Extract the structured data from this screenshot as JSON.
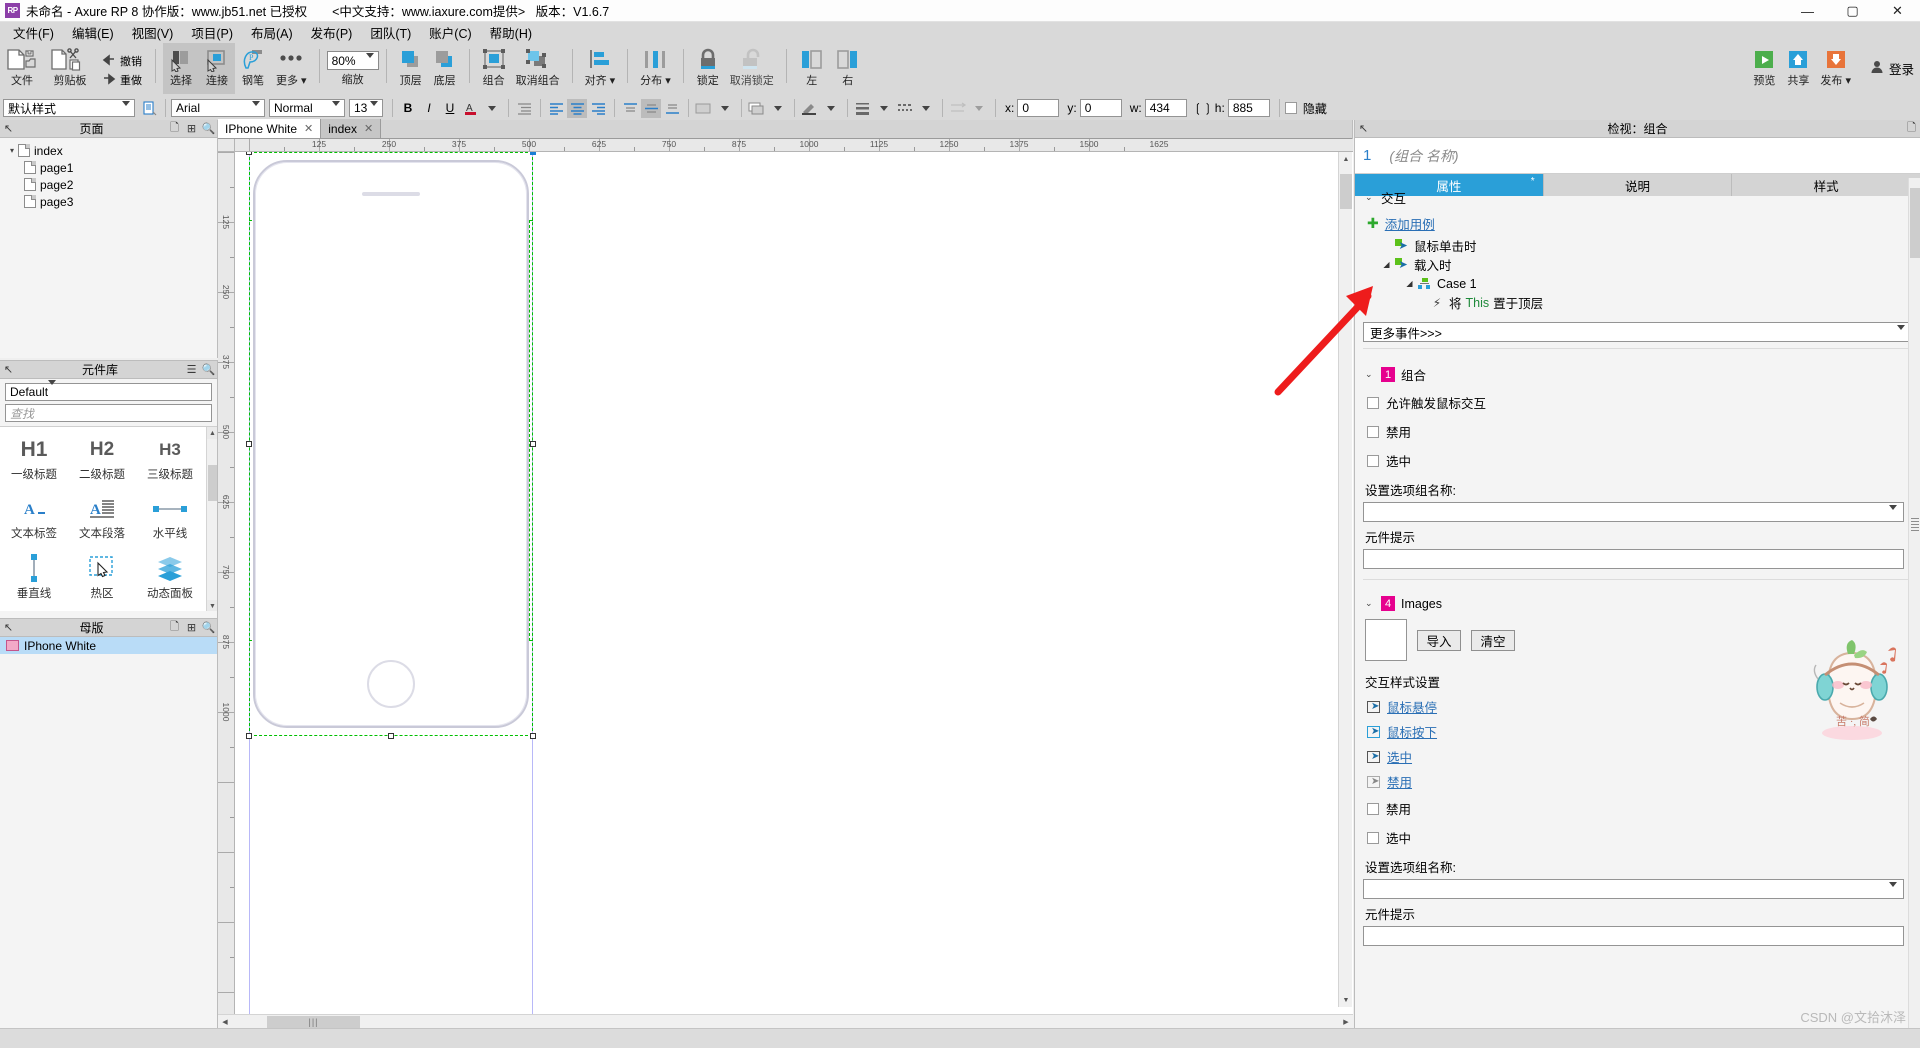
{
  "window": {
    "logo_text": "RP",
    "title_main": "未命名 - Axure RP 8 协作版：www.jb51.net 已授权",
    "title_note": "<中文支持：www.iaxure.com提供>",
    "title_version": "版本：V1.6.7",
    "minimize": "—",
    "maximize": "▢",
    "close": "✕"
  },
  "menu": [
    {
      "label": "文件(F)"
    },
    {
      "label": "编辑(E)"
    },
    {
      "label": "视图(V)"
    },
    {
      "label": "项目(P)"
    },
    {
      "label": "布局(A)"
    },
    {
      "label": "发布(P)"
    },
    {
      "label": "团队(T)"
    },
    {
      "label": "账户(C)"
    },
    {
      "label": "帮助(H)"
    }
  ],
  "toolbar": {
    "file_label": "文件",
    "clipboard_label": "剪贴板",
    "undo_label": "撤销",
    "redo_label": "重做",
    "select_label": "选择",
    "connect_label": "连接",
    "pen_label": "钢笔",
    "more_label": "更多",
    "zoom_label": "缩放",
    "zoom_value": "80%",
    "front_label": "顶层",
    "back_label": "底层",
    "group_label": "组合",
    "ungroup_label": "取消组合",
    "align_label": "对齐",
    "distribute_label": "分布",
    "lock_label": "锁定",
    "unlock_label": "取消锁定",
    "left_label": "左",
    "right_label": "右",
    "preview_label": "预览",
    "share_label": "共享",
    "publish_label": "发布",
    "login_label": "登录"
  },
  "stylebar": {
    "style_value": "默认样式",
    "font_value": "Arial",
    "weight_value": "Normal",
    "size_value": "13",
    "bold": "B",
    "italic": "I",
    "underline": "U",
    "x_label": "x:",
    "x_value": "0",
    "y_label": "y:",
    "y_value": "0",
    "w_label": "w:",
    "w_value": "434",
    "h_label": "h:",
    "h_value": "885",
    "hide_label": "隐藏"
  },
  "pages_panel": {
    "title": "页面",
    "items": [
      {
        "label": "index",
        "depth": 0,
        "twisty": "▾"
      },
      {
        "label": "page1",
        "depth": 1,
        "twisty": ""
      },
      {
        "label": "page2",
        "depth": 1,
        "twisty": ""
      },
      {
        "label": "page3",
        "depth": 1,
        "twisty": ""
      }
    ]
  },
  "library_panel": {
    "title": "元件库",
    "selected": "Default",
    "search_placeholder": "查找",
    "widgets": [
      {
        "glyph": "H1",
        "label": "一级标题"
      },
      {
        "glyph": "H2",
        "label": "二级标题"
      },
      {
        "glyph": "H3",
        "label": "三级标题"
      },
      {
        "glyph": "A_",
        "label": "文本标签"
      },
      {
        "glyph": "A≡",
        "label": "文本段落"
      },
      {
        "glyph": "—",
        "label": "水平线"
      },
      {
        "glyph": "|",
        "label": "垂直线"
      },
      {
        "glyph": "↖",
        "label": "热区"
      },
      {
        "glyph": "▤",
        "label": "动态面板"
      }
    ]
  },
  "masters_panel": {
    "title": "母版",
    "items": [
      {
        "label": "IPhone White"
      }
    ]
  },
  "canvas": {
    "tabs": [
      {
        "label": "IPhone White",
        "active": true,
        "close": "✕"
      },
      {
        "label": "index",
        "active": false,
        "close": "✕"
      }
    ],
    "ruler_h_labels": [
      "125",
      "250",
      "375",
      "500",
      "625",
      "750",
      "875",
      "1000",
      "1125",
      "1250",
      "1375",
      "1500",
      "1625"
    ],
    "ruler_v_labels": [
      "125",
      "250",
      "375",
      "500",
      "625",
      "750",
      "875",
      "1000"
    ],
    "scroll_thumb_grip": "|||"
  },
  "inspector": {
    "header_title": "检视：组合",
    "name_number": "1",
    "name_placeholder": "(组合 名称)",
    "tabs": [
      {
        "label": "属性",
        "active": true,
        "star": "*"
      },
      {
        "label": "说明",
        "active": false,
        "star": ""
      },
      {
        "label": "样式",
        "active": false,
        "star": ""
      }
    ],
    "interaction": {
      "section_title": "交互",
      "add_case_label": "添加用例",
      "events": [
        {
          "label": "鼠标单击时",
          "twisty": "",
          "indent": 0,
          "kind": "event"
        },
        {
          "label": "载入时",
          "twisty": "◢",
          "indent": 0,
          "kind": "event"
        },
        {
          "label": "Case 1",
          "twisty": "◢",
          "indent": 1,
          "kind": "case"
        },
        {
          "label_pre": "将",
          "label_mid": "This",
          "label_post": "置于顶层",
          "twisty": "",
          "indent": 2,
          "kind": "action"
        }
      ],
      "more_events": "更多事件>>>"
    },
    "group_section": {
      "badge": "1",
      "title": "组合",
      "checkboxes": [
        {
          "label": "允许触发鼠标交互",
          "checked": false
        },
        {
          "label": "禁用",
          "checked": false
        },
        {
          "label": "选中",
          "checked": false
        }
      ],
      "option_group_label": "设置选项组名称:",
      "option_group_value": "",
      "tooltip_label": "元件提示",
      "tooltip_value": ""
    },
    "images_section": {
      "badge": "4",
      "title": "Images",
      "import_label": "导入",
      "clear_label": "清空",
      "interaction_style_label": "交互样式设置",
      "style_links": [
        {
          "label": "鼠标悬停"
        },
        {
          "label": "鼠标按下"
        },
        {
          "label": "选中"
        },
        {
          "label": "禁用"
        }
      ],
      "checkboxes": [
        {
          "label": "禁用",
          "checked": false
        },
        {
          "label": "选中",
          "checked": false
        }
      ],
      "option_group_label": "设置选项组名称:",
      "option_group_value": "",
      "tooltip_label": "元件提示",
      "tooltip_value": ""
    }
  },
  "watermark": {
    "csdn": "CSDN @文拾沐泽"
  },
  "colors": {
    "accent_blue": "#2a9fd8",
    "selection_green": "#00c000",
    "badge_pink": "#e6008e",
    "link_blue": "#2a6fb5",
    "arrow_red": "#ee1c1c"
  }
}
